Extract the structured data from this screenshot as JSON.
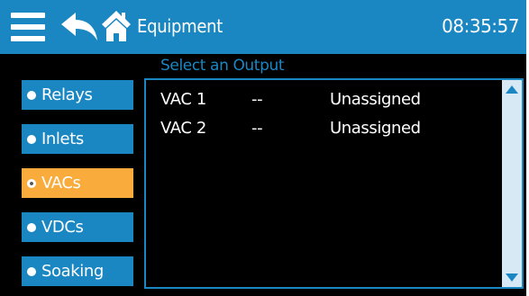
{
  "header": {
    "title": "Equipment",
    "time": "08:35:57"
  },
  "sidebar": {
    "items": [
      {
        "label": "Relays",
        "active": false
      },
      {
        "label": "Inlets",
        "active": false
      },
      {
        "label": "VACs",
        "active": true
      },
      {
        "label": "VDCs",
        "active": false
      },
      {
        "label": "Soaking",
        "active": false
      }
    ]
  },
  "panel": {
    "label": "Select an Output",
    "rows": [
      {
        "name": "VAC 1",
        "value": "--",
        "status": "Unassigned"
      },
      {
        "name": "VAC 2",
        "value": "--",
        "status": "Unassigned"
      }
    ]
  },
  "colors": {
    "accent": "#1a87c3",
    "active": "#f9ab3b",
    "background": "#000000",
    "scroll_track": "#d6e9f4"
  },
  "icons": [
    "menu-icon",
    "back-arrow-icon",
    "home-icon",
    "scroll-up-arrow-icon",
    "scroll-down-arrow-icon"
  ]
}
